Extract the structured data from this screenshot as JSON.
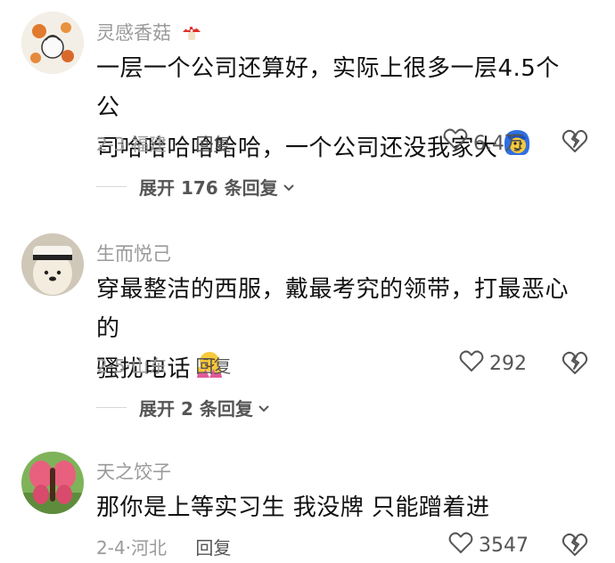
{
  "comments": [
    {
      "username": "灵感香菇",
      "content_line1": "一层一个公司还算好，实际上很多一层4.5个公",
      "content_line2": "司哈哈哈哈哈哈，一个公司还没我家大",
      "date": "2-3",
      "location": "福建",
      "reply_label": "回复",
      "likes": "6.4万",
      "expand_label": "展开 176 条回复"
    },
    {
      "username": "生而悦己",
      "content_line1": "穿最整洁的西服，戴最考究的领带，打最恶心的",
      "content_line2": "骚扰电话",
      "date": "2-5",
      "location": "山东",
      "reply_label": "回复",
      "likes": "292",
      "expand_label": "展开 2 条回复"
    },
    {
      "username": "天之饺子",
      "content_line1": "那你是上等实习生 我没牌 只能蹭着进",
      "date": "2-4",
      "location": "河北",
      "reply_label": "回复",
      "likes": "3547"
    }
  ],
  "separator": "·",
  "colors": {
    "muted": "#9a9a9a",
    "text": "#111111",
    "action": "#555555"
  }
}
